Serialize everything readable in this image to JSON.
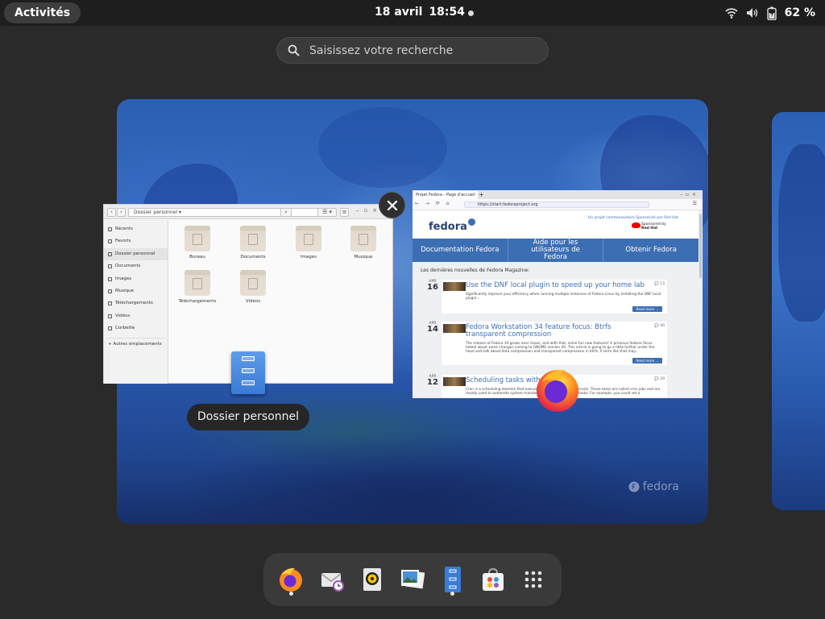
{
  "topbar": {
    "activities_label": "Activités",
    "date": "18 avril",
    "time": "18:54",
    "battery": "62 %"
  },
  "search": {
    "placeholder": "Saisissez votre recherche"
  },
  "workspace": {
    "brand": "fedora"
  },
  "file_manager": {
    "label": "Dossier personnel",
    "path": "Dossier personnel",
    "sidebar": [
      "Récents",
      "Favoris",
      "Dossier personnel",
      "Documents",
      "Images",
      "Musique",
      "Téléchargements",
      "Vidéos",
      "Corbeille",
      "+ Autres emplacements"
    ],
    "folders": [
      "Bureau",
      "Documents",
      "Images",
      "Musique",
      "Téléchargements",
      "Vidéos"
    ]
  },
  "browser": {
    "tab_title": "Projet Fedora - Page d'accueil",
    "url": "https://start.fedoraproject.org",
    "site_logo": "fedora",
    "tagline": "Un projet communautaire Sponsorisé par Red Hat",
    "sponsor_line1": "Sponsored by",
    "sponsor_line2": "Red Hat",
    "nav": [
      "Documentation Fedora",
      "Aide pour les utilisateurs de Fedora",
      "Obtenir Fedora"
    ],
    "news_heading": "Les dernières nouvelles de Fedora Magazine:",
    "articles": [
      {
        "month": "APR",
        "day": "16",
        "title": "Use the DNF local plugin to speed up your home lab",
        "count": "13",
        "excerpt": "Significantly improve your efficiency when running multiple instances of Fedora Linux by installing the DNF local plugin...",
        "button": "Read more ..."
      },
      {
        "month": "APR",
        "day": "14",
        "title": "Fedora Workstation 34 feature focus: Btrfs transparent compression",
        "count": "40",
        "excerpt": "The release of Fedora 34 grows ever closer, and with that, some fun new features! A previous feature focus talked about some changes coming to GNOME version 40. This article is going to go a little further under the hood and talk about data compression and transparent compression in btrfs. A term like that may...",
        "button": "Read more ..."
      },
      {
        "month": "APR",
        "day": "12",
        "title": "Scheduling tasks with",
        "count": "29",
        "excerpt": "Cron is a scheduling daemon that executes tasks at specified intervals. These tasks are called cron jobs and are mostly used to automate system maintenance or administration tasks. For example, you could set a",
        "button": ""
      }
    ]
  },
  "dash": {
    "apps": [
      "firefox-icon",
      "evolution-mail-icon",
      "rhythmbox-icon",
      "photos-icon",
      "files-icon",
      "software-icon",
      "show-apps-icon"
    ]
  },
  "colors": {
    "accent": "#3c6eb4",
    "panel": "#1e1e1e",
    "dash": "#3a3a3a"
  }
}
